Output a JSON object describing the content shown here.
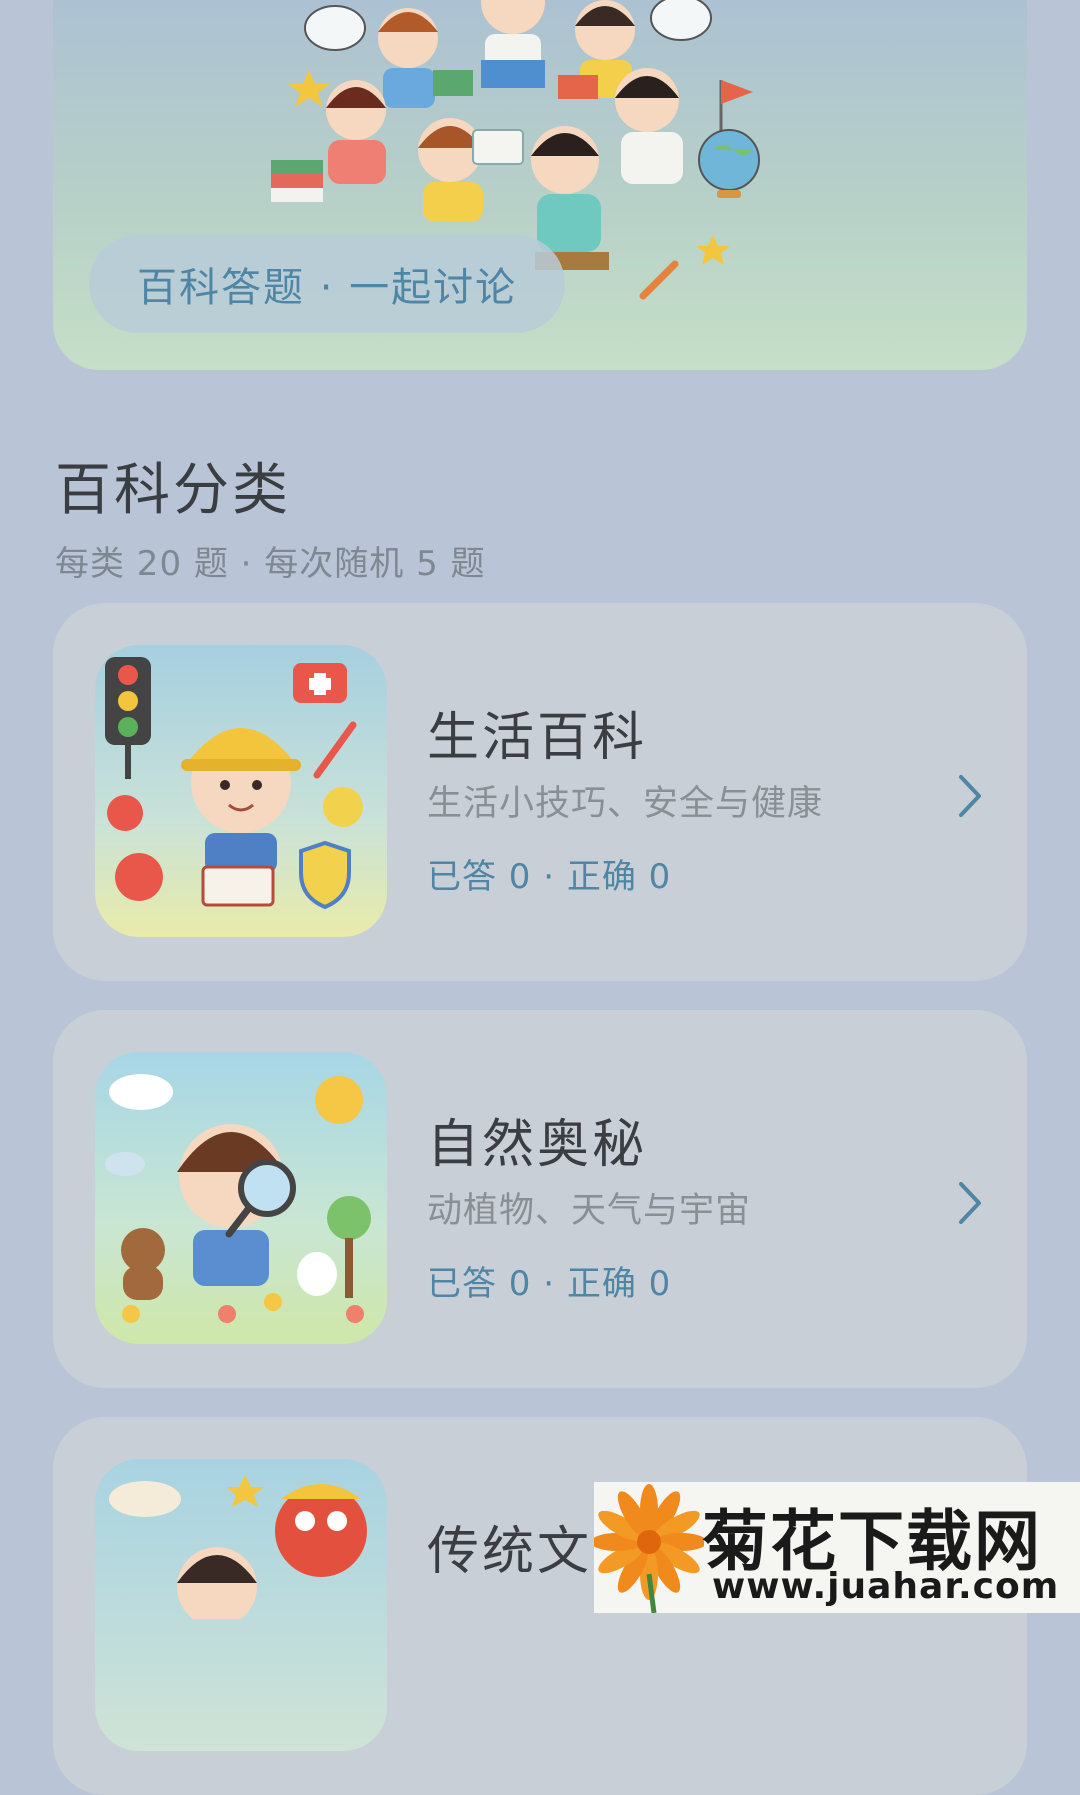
{
  "banner": {
    "label": "百科答题 · 一起讨论"
  },
  "section": {
    "title": "百科分类",
    "subtitle": "每类 20 题 · 每次随机 5 题"
  },
  "categories": [
    {
      "title": "生活百科",
      "desc": "生活小技巧、安全与健康",
      "stats": "已答 0 · 正确 0"
    },
    {
      "title": "自然奥秘",
      "desc": "动植物、天气与宇宙",
      "stats": "已答 0 · 正确 0"
    },
    {
      "title": "传统文化"
    }
  ],
  "watermark": {
    "brand": "菊花下载网",
    "url": "www.juahar.com"
  },
  "colors": {
    "accent": "#4f86a6",
    "background": "#b9c5d6",
    "card": "#c9cfd6"
  }
}
